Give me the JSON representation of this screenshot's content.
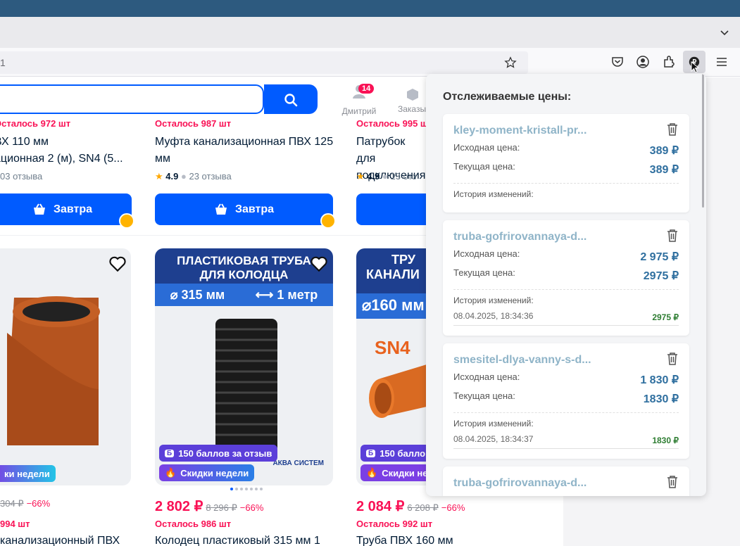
{
  "browser": {
    "url_fragment": "1",
    "icons": [
      "star-icon",
      "pocket-icon",
      "account-icon",
      "extensions-icon",
      "price-tracker-extension-icon",
      "menu-icon"
    ]
  },
  "header": {
    "user_label": "Дмитрий",
    "notifications_badge": "14",
    "orders_label": "Заказы"
  },
  "products_top": [
    {
      "stock": "Осталось 972 шт",
      "name": "ВХ 110 мм",
      "name2": "ационная 2 (м), SN4 (5...",
      "rating_text": "03 отзыва",
      "rating": "",
      "buy": "Завтра"
    },
    {
      "stock": "Осталось 987 шт",
      "name": "Муфта канализационная ПВХ 125",
      "name2": "мм",
      "rating": "4.9",
      "rating_text": "23 отзыва",
      "buy": "Завтра"
    },
    {
      "stock": "Осталось 995 ш",
      "name": "Патрубок для",
      "name2": "подключения",
      "rating": "4.9",
      "rating_text": "13 отз",
      "buy": ""
    }
  ],
  "products_bottom": [
    {
      "tag_week": "ки недели",
      "price": "",
      "old": "304 ₽",
      "disc": "−66%",
      "stock": "994 шт",
      "name": "канализационный ПВХ"
    },
    {
      "banner_line1": "ПЛАСТИКОВАЯ ТРУБА",
      "banner_line2": "ДЛЯ КОЛОДЦА",
      "size": "315 мм",
      "length": "1 метр",
      "tag_points": "150 баллов за отзыв",
      "tag_week": "Скидки недели",
      "brand": "АКВА СИСТЕМ",
      "price": "2 802 ₽",
      "old": "8 296 ₽",
      "disc": "−66%",
      "stock": "Осталось 986 шт",
      "name": "Колодец пластиковый 315 мм 1"
    },
    {
      "banner_line1": "ТРУ",
      "banner_line2": "КАНАЛИ",
      "size": "160 мм",
      "sn": "SN4",
      "tag_points": "150 балло",
      "tag_week": "Скидки не",
      "price": "2 084 ₽",
      "old": "6 208 ₽",
      "disc": "−66%",
      "stock": "Осталось 992 шт",
      "name": "Труба ПВХ 160 мм"
    }
  ],
  "popup": {
    "title": "Отслеживаемые цены:",
    "labels": {
      "original": "Исходная цена:",
      "current": "Текущая цена:",
      "history": "История изменений:"
    },
    "items": [
      {
        "name": "kley-moment-kristall-pr...",
        "original": "389 ₽",
        "current": "389 ₽",
        "history_date": "",
        "history_price": ""
      },
      {
        "name": "truba-gofrirovannaya-d...",
        "original": "2 975 ₽",
        "current": "2975 ₽",
        "history_date": "08.04.2025, 18:34:36",
        "history_price": "2975 ₽"
      },
      {
        "name": "smesitel-dlya-vanny-s-d...",
        "original": "1 830 ₽",
        "current": "1830 ₽",
        "history_date": "08.04.2025, 18:34:37",
        "history_price": "1830 ₽"
      },
      {
        "name": "truba-gofrirovannaya-d..."
      }
    ]
  },
  "colors": {
    "brand_blue": "#005bff",
    "price_pink": "#f91155",
    "popup_value_blue": "#2f6f9f",
    "history_green": "#2e7d32"
  }
}
